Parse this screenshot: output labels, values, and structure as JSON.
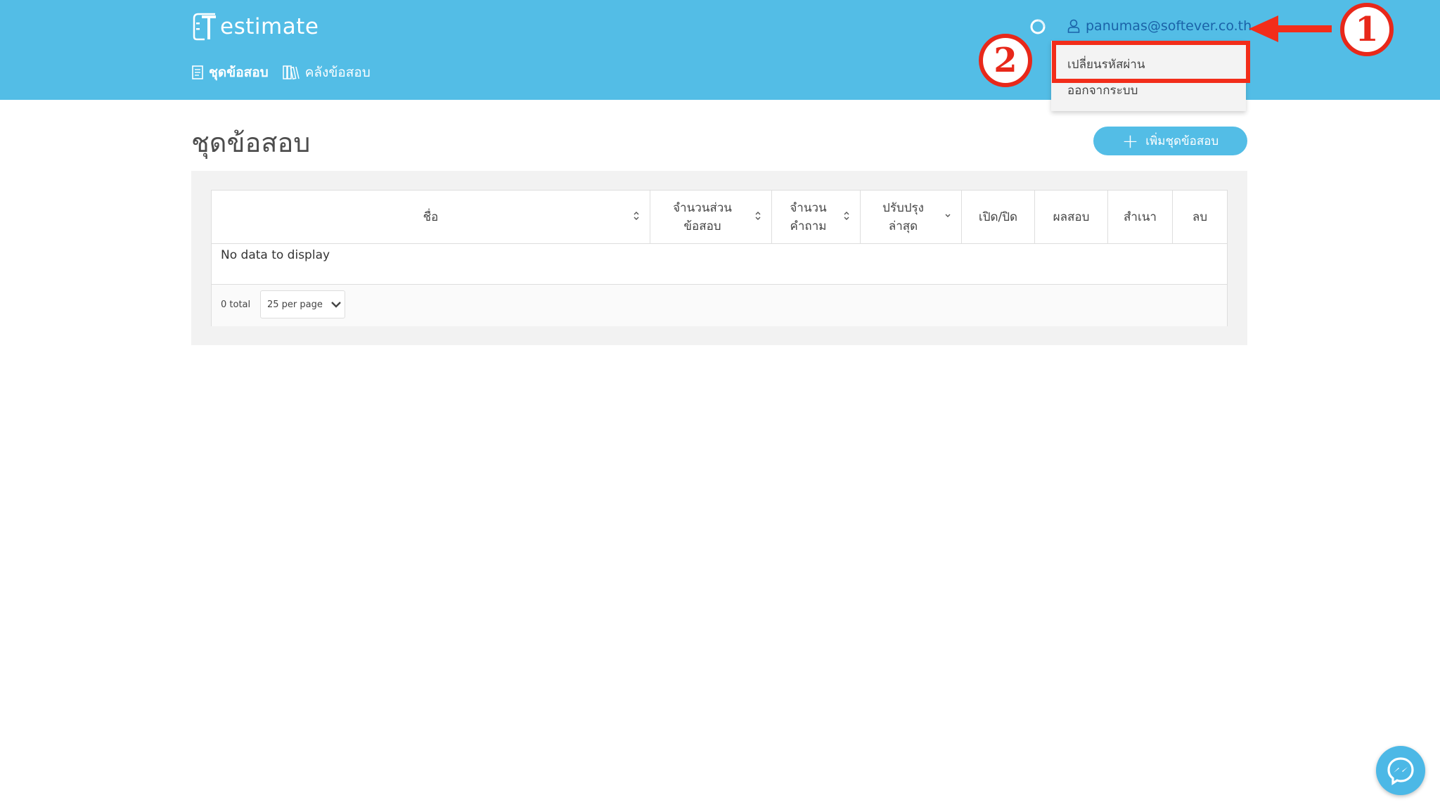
{
  "app": {
    "logo_text": "estimate",
    "logo_letter": "T"
  },
  "nav": {
    "items": [
      {
        "label": "ชุดข้อสอบ",
        "active": true,
        "icon": "document-icon"
      },
      {
        "label": "คลังข้อสอบ",
        "active": false,
        "icon": "books-icon"
      }
    ]
  },
  "user": {
    "email": "panumas@softever.co.th",
    "menu": [
      {
        "label": "เปลี่ยนรหัสผ่าน",
        "highlighted": true
      },
      {
        "label": "ออกจากระบบ",
        "highlighted": false
      }
    ]
  },
  "annotations": {
    "marker_1": "1",
    "marker_2": "2"
  },
  "page": {
    "title": "ชุดข้อสอบ",
    "add_button": "เพิ่มชุดข้อสอบ"
  },
  "table": {
    "columns": [
      "ชื่อ",
      "จำนวนส่วน ข้อสอบ",
      "จำนวน คำถาม",
      "ปรับปรุง ล่าสุด",
      "เปิด/ปิด",
      "ผลสอบ",
      "สำเนา",
      "ลบ"
    ],
    "empty_text": "No data to display",
    "total_text": "0 total",
    "per_page": "25 per page"
  },
  "colors": {
    "header": "#53bde6",
    "link": "#1a62a8",
    "annotation": "#e8281a"
  }
}
